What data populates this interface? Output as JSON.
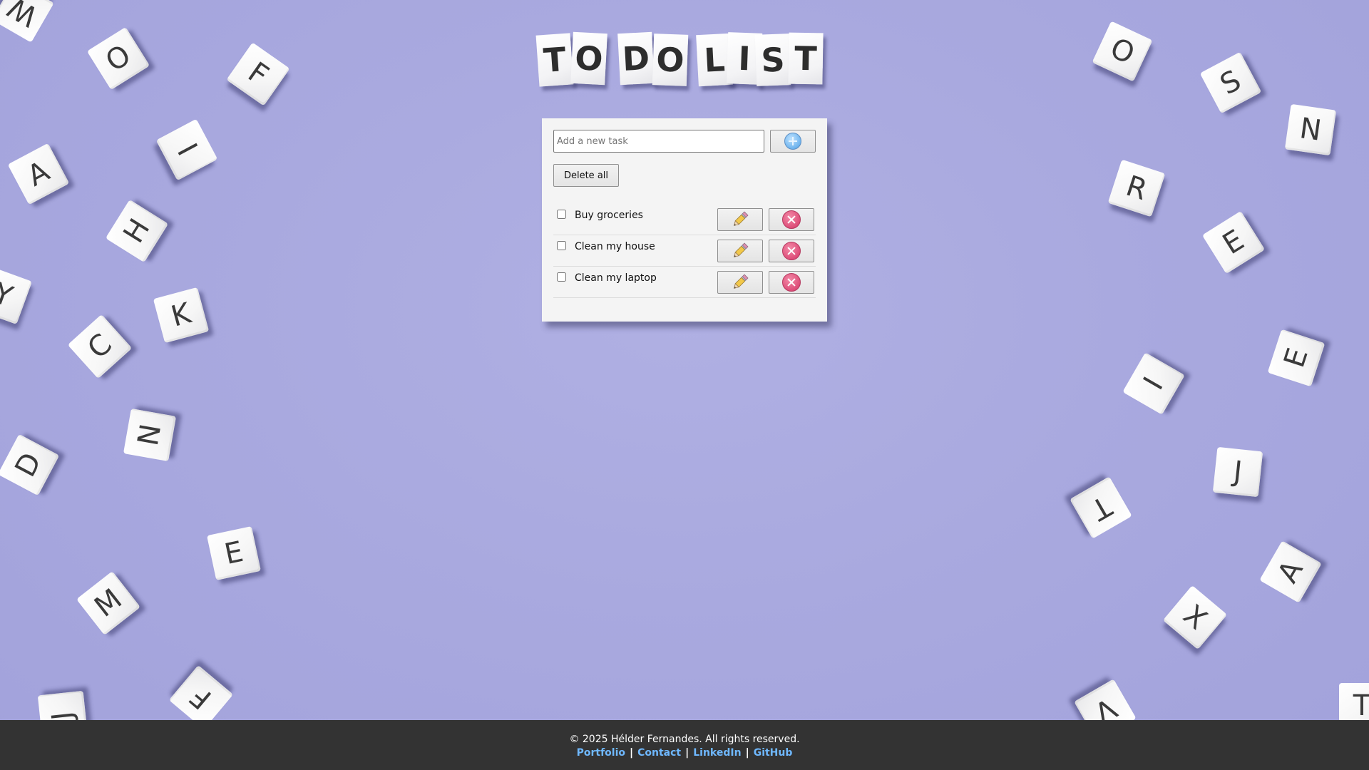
{
  "background_tiles": [
    "W",
    "O",
    "F",
    "I",
    "A",
    "H",
    "Y",
    "K",
    "C",
    "N",
    "D",
    "E",
    "M",
    "J",
    "F",
    "O",
    "S",
    "N",
    "R",
    "E",
    "E",
    "I",
    "J",
    "T",
    "A",
    "X",
    "V",
    "T"
  ],
  "title": {
    "letters": [
      "T",
      "O",
      "D",
      "O",
      "L",
      "I",
      "S",
      "T"
    ]
  },
  "todo": {
    "input_placeholder": "Add a new task",
    "input_value": "",
    "add_icon": "plus-circle-icon",
    "delete_all_label": "Delete all",
    "tasks": [
      {
        "label": "Buy groceries",
        "checked": false
      },
      {
        "label": "Clean my house",
        "checked": false
      },
      {
        "label": "Clean my laptop",
        "checked": false
      }
    ],
    "edit_icon": "pencil-icon",
    "remove_icon": "x-circle-icon"
  },
  "footer": {
    "copyright": "© 2025 Hélder Fernandes. All rights reserved.",
    "links": [
      "Portfolio",
      "Contact",
      "LinkedIn",
      "GitHub"
    ],
    "link_color": "#6fb8ff",
    "background_color": "#333333"
  },
  "colors": {
    "page_background": "#a9a9df",
    "card_background": "#f4f4f4",
    "remove_accent": "#dc4a76",
    "add_accent": "#6fb4ee"
  }
}
